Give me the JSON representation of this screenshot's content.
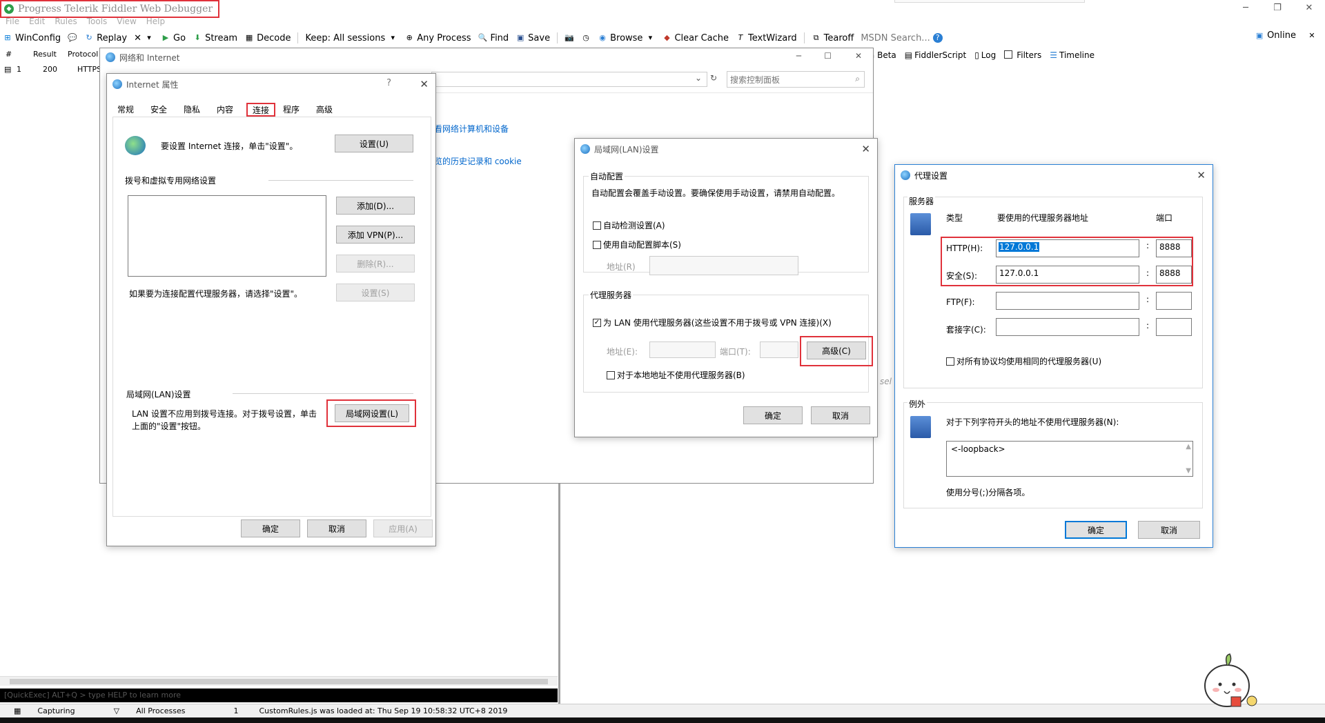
{
  "fiddler": {
    "title": "Progress Telerik Fiddler Web Debugger",
    "menu": [
      "File",
      "Edit",
      "Rules",
      "Tools",
      "View",
      "Help"
    ],
    "toolbar": {
      "winconfig": "WinConfig",
      "replay": "Replay",
      "remove": "✕",
      "go": "Go",
      "stream": "Stream",
      "decode": "Decode",
      "keep": "Keep: All sessions",
      "any_process": "Any Process",
      "find": "Find",
      "save": "Save",
      "browse": "Browse",
      "clear_cache": "Clear Cache",
      "textwizard": "TextWizard",
      "tearoff": "Tearoff",
      "msdn_search": "MSDN Search...",
      "online": "Online"
    },
    "session_columns": [
      "#",
      "Result",
      "Protocol"
    ],
    "session_row": {
      "num": "1",
      "result": "200",
      "protocol": "HTTPS"
    },
    "right_tabs": [
      "ra Beta",
      "FiddlerScript",
      "Log",
      "Filters",
      "Timeline"
    ],
    "quickexec": "[QuickExec] ALT+Q > type HELP to learn more",
    "status": {
      "capturing": "Capturing",
      "processes": "All Processes",
      "count": "1",
      "message": "CustomRules.js was loaded at: Thu Sep 19 10:58:32 UTC+8 2019"
    }
  },
  "network_window": {
    "title": "网络和 Internet",
    "search_placeholder": "搜索控制面板",
    "link1": "看网络计算机和设备",
    "link2": "览的历史记录和 cookie",
    "partial_text": "sel"
  },
  "internet_props": {
    "title": "Internet 属性",
    "tabs": [
      "常规",
      "安全",
      "隐私",
      "内容",
      "连接",
      "程序",
      "高级"
    ],
    "setup_text": "要设置 Internet 连接，单击\"设置\"。",
    "setup_btn": "设置(U)",
    "dialup_group": "拨号和虚拟专用网络设置",
    "add_btn": "添加(D)...",
    "add_vpn_btn": "添加 VPN(P)...",
    "remove_btn": "删除(R)...",
    "settings_btn": "设置(S)",
    "proxy_hint": "如果要为连接配置代理服务器，请选择\"设置\"。",
    "lan_group": "局域网(LAN)设置",
    "lan_text1": "LAN 设置不应用到拨号连接。对于拨号设置，单击",
    "lan_text2": "上面的\"设置\"按钮。",
    "lan_btn": "局域网设置(L)",
    "ok": "确定",
    "cancel": "取消",
    "apply": "应用(A)"
  },
  "lan_settings": {
    "title": "局域网(LAN)设置",
    "auto_group": "自动配置",
    "auto_desc": "自动配置会覆盖手动设置。要确保使用手动设置，请禁用自动配置。",
    "auto_detect": "自动检测设置(A)",
    "use_script": "使用自动配置脚本(S)",
    "address_r": "地址(R)",
    "proxy_group": "代理服务器",
    "use_proxy": "为 LAN 使用代理服务器(这些设置不用于拨号或 VPN 连接)(X)",
    "address_e": "地址(E):",
    "port_t": "端口(T):",
    "advanced_btn": "高级(C)",
    "bypass_local": "对于本地地址不使用代理服务器(B)",
    "ok": "确定",
    "cancel": "取消"
  },
  "proxy_settings": {
    "title": "代理设置",
    "servers_group": "服务器",
    "col_type": "类型",
    "col_address": "要使用的代理服务器地址",
    "col_port": "端口",
    "rows": [
      {
        "label": "HTTP(H):",
        "address": "127.0.0.1",
        "port": "8888"
      },
      {
        "label": "安全(S):",
        "address": "127.0.0.1",
        "port": "8888"
      },
      {
        "label": "FTP(F):",
        "address": "",
        "port": ""
      },
      {
        "label": "套接字(C):",
        "address": "",
        "port": ""
      }
    ],
    "colon": ":",
    "same_proxy": "对所有协议均使用相同的代理服务器(U)",
    "exceptions_group": "例外",
    "exceptions_desc": "对于下列字符开头的地址不使用代理服务器(N):",
    "exceptions_value": "<-loopback>",
    "separator_hint": "使用分号(;)分隔各项。",
    "ok": "确定",
    "cancel": "取消"
  }
}
